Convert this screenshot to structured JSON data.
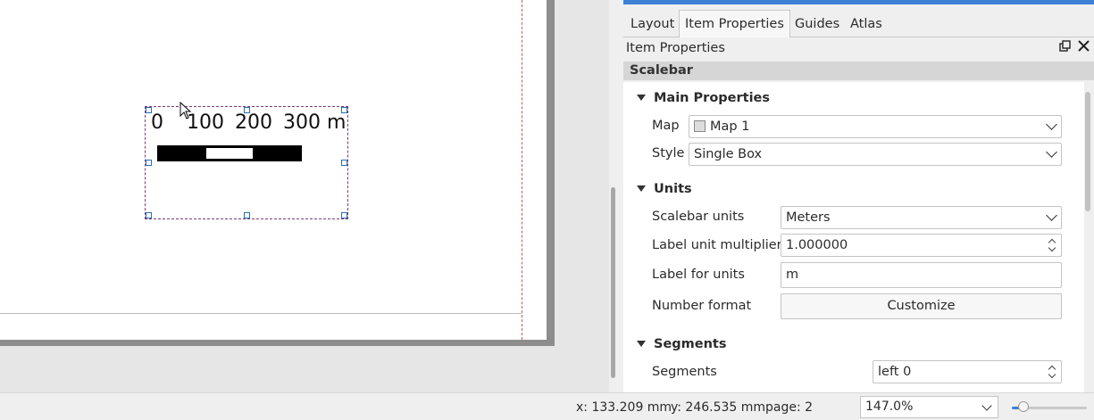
{
  "scalebar_preview": {
    "labels": [
      "0",
      "100",
      "200",
      "300 m"
    ]
  },
  "panel": {
    "tabs": [
      "Layout",
      "Item Properties",
      "Guides",
      "Atlas"
    ],
    "active_tab": "Item Properties",
    "dock_title": "Item Properties",
    "section": "Scalebar",
    "groups": {
      "main": "Main Properties",
      "units": "Units",
      "segments": "Segments"
    },
    "fields": {
      "map_label": "Map",
      "map_value": "Map 1",
      "style_label": "Style",
      "style_value": "Single Box",
      "scalebar_units_label": "Scalebar units",
      "scalebar_units_value": "Meters",
      "label_unit_multiplier_label": "Label unit multiplier",
      "label_unit_multiplier_value": "1.000000",
      "label_for_units_label": "Label for units",
      "label_for_units_value": "m",
      "number_format_label": "Number format",
      "number_format_button": "Customize",
      "segments_label": "Segments",
      "segments_value": "left 0"
    }
  },
  "status": {
    "x": "x: 133.209 mm",
    "y": "y: 246.535 mm",
    "page": "page: 2",
    "zoom": "147.0%",
    "zoom_slider_fraction": 0.15
  },
  "colors": {
    "accent": "#3e80d6",
    "selection": "#2a6fb0"
  }
}
